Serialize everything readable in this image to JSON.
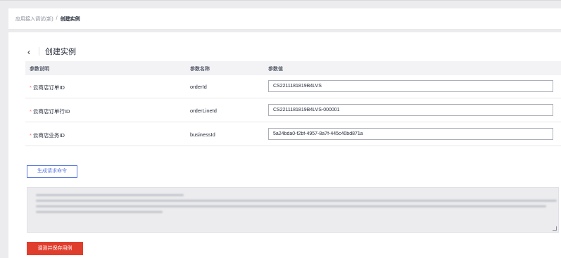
{
  "breadcrumb": {
    "parent": "应用接入调试(新)",
    "separator": "/",
    "current": "创建实例"
  },
  "page": {
    "back_icon": "‹",
    "title": "创建实例"
  },
  "table": {
    "headers": [
      "参数说明",
      "参数名称",
      "参数值"
    ],
    "rows": [
      {
        "required": "*",
        "label": "云商店订单ID",
        "name": "orderId",
        "value": "CS2211181819B4LVS"
      },
      {
        "required": "*",
        "label": "云商店订单行ID",
        "name": "orderLineId",
        "value": "CS2211181819B4LVS-000001"
      },
      {
        "required": "*",
        "label": "云商店业务ID",
        "name": "businessId",
        "value": "5a24bda0-f2bf-4957-8a7f-445c40bd871a"
      }
    ]
  },
  "actions": {
    "generate_label": "生成请求命令",
    "save_label": "调测并保存用例"
  },
  "colors": {
    "primary": "#5e7ce0",
    "danger": "#e03e2d",
    "required": "#f66f6a"
  }
}
